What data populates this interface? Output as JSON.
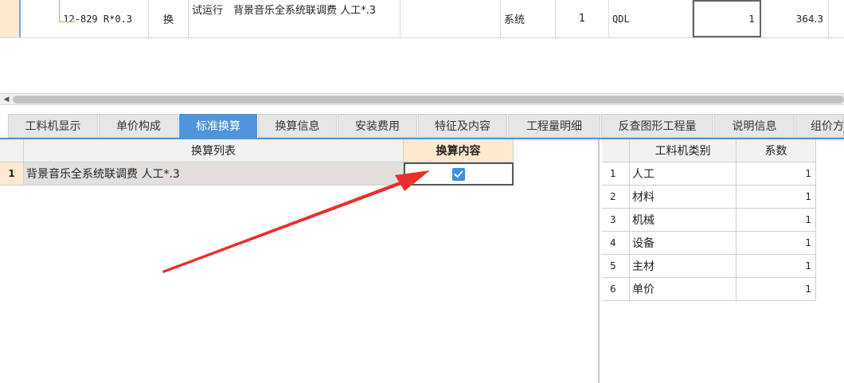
{
  "top_row": {
    "code": "12-829 R*0.3",
    "swap": "换",
    "name": "试运行　背景音乐全系统联调费 人工*.3",
    "unit": "系统",
    "quantity": "1",
    "qdl": "QDL",
    "value": "1",
    "price": "364.3"
  },
  "tabs": [
    {
      "label": "工料机显示"
    },
    {
      "label": "单价构成"
    },
    {
      "label": "标准换算"
    },
    {
      "label": "换算信息"
    },
    {
      "label": "安装费用"
    },
    {
      "label": "特征及内容"
    },
    {
      "label": "工程量明细"
    },
    {
      "label": "反查图形工程量"
    },
    {
      "label": "说明信息"
    },
    {
      "label": "组价方"
    }
  ],
  "active_tab": "标准换算",
  "conversion_table": {
    "headers": {
      "list": "换算列表",
      "content": "换算内容"
    },
    "rows": [
      {
        "num": "1",
        "text": "背景音乐全系统联调费 人工*.3",
        "checked": true
      }
    ]
  },
  "coef_table": {
    "headers": {
      "category": "工料机类别",
      "coef": "系数"
    },
    "rows": [
      {
        "num": "1",
        "category": "人工",
        "coef": "1"
      },
      {
        "num": "2",
        "category": "材料",
        "coef": "1"
      },
      {
        "num": "3",
        "category": "机械",
        "coef": "1"
      },
      {
        "num": "4",
        "category": "设备",
        "coef": "1"
      },
      {
        "num": "5",
        "category": "主材",
        "coef": "1"
      },
      {
        "num": "6",
        "category": "单价",
        "coef": "1"
      }
    ]
  },
  "colors": {
    "accent": "#4f95dc",
    "row_highlight": "#fde9cf",
    "arrow": "#e8302a",
    "checkbox": "#3b8ee0"
  },
  "icons": {
    "scroll_left": "chevron-left-icon",
    "check": "checkmark-icon"
  }
}
